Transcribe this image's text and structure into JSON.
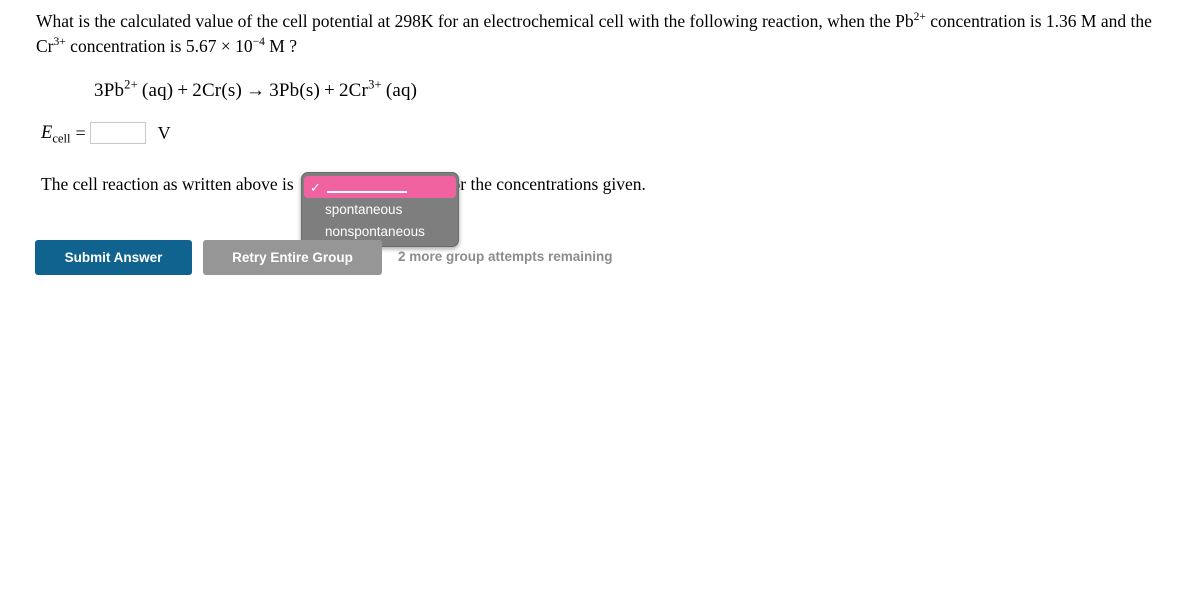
{
  "question": {
    "part1": "What is the calculated value of the cell potential at 298K for an electrochemical cell with the following reaction, when the ",
    "ion1_symbol": "Pb",
    "ion1_charge": "2+",
    "part2": " concentration is ",
    "conc1": "1.36 M",
    "part3": " and the ",
    "ion2_symbol": "Cr",
    "ion2_charge": "3+",
    "part4": " concentration is ",
    "conc2_mantissa": "5.67",
    "conc2_times": "×",
    "conc2_base": "10",
    "conc2_exponent": "−4",
    "conc2_unit": "M",
    "terminator": "?"
  },
  "equation": {
    "r1_coeff": "3",
    "r1_symbol": "Pb",
    "r1_charge": "2+",
    "r1_state": "(aq)",
    "plus1": "+",
    "r2_coeff": "2",
    "r2_symbol": "Cr",
    "r2_state": "(s)",
    "arrow": "→",
    "p1_coeff": "3",
    "p1_symbol": "Pb",
    "p1_state": "(s)",
    "plus2": "+",
    "p2_coeff": "2",
    "p2_symbol": "Cr",
    "p2_charge": "3+",
    "p2_state": "(aq)"
  },
  "ecell": {
    "symbol": "E",
    "subscript": "cell",
    "equals": "=",
    "value": "",
    "placeholder": "",
    "unit": "V"
  },
  "statement": {
    "before": "The cell reaction as written above is",
    "after": "for the concentrations given."
  },
  "dropdown": {
    "open": true,
    "selected_index": 0,
    "highlight_color": "#f063a0",
    "background_color": "#7e7e7e",
    "options": [
      {
        "label": "",
        "is_blank": true,
        "checked": true
      },
      {
        "label": "spontaneous",
        "is_blank": false,
        "checked": false
      },
      {
        "label": "nonspontaneous",
        "is_blank": false,
        "checked": false
      }
    ]
  },
  "buttons": {
    "submit_label": "Submit Answer",
    "submit_color": "#10628f",
    "retry_label": "Retry Entire Group",
    "retry_color": "#969696"
  },
  "status": {
    "attempts_text": "2 more group attempts remaining",
    "attempts_color": "#8c8c8c"
  }
}
